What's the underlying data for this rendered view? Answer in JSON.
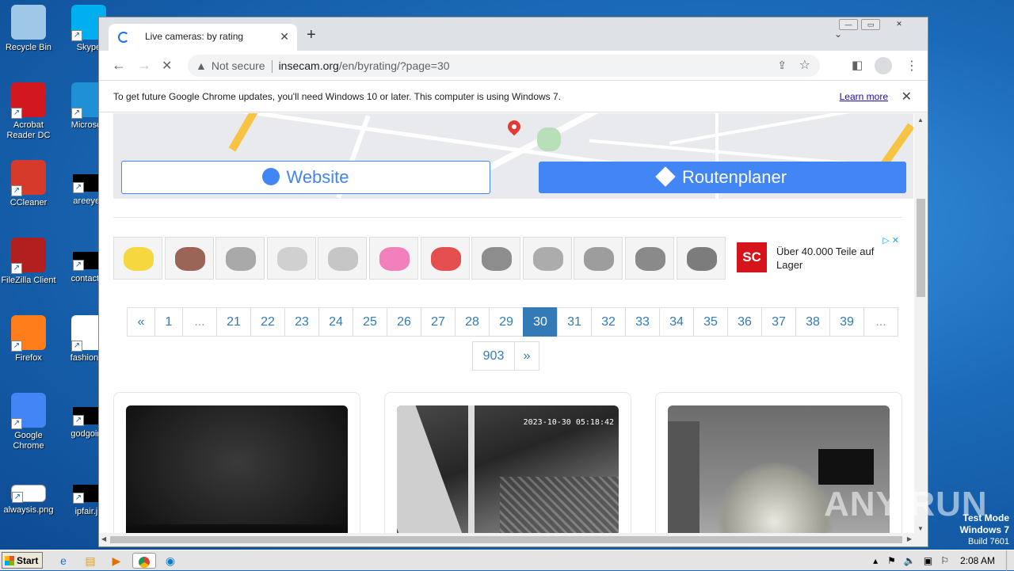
{
  "desktop": {
    "icons_col1": [
      {
        "label": "Recycle Bin",
        "icon": "recycle-bin-icon"
      },
      {
        "label": "Acrobat Reader DC",
        "icon": "acrobat-icon"
      },
      {
        "label": "CCleaner",
        "icon": "ccleaner-icon"
      },
      {
        "label": "FileZilla Client",
        "icon": "filezilla-icon"
      },
      {
        "label": "Firefox",
        "icon": "firefox-icon"
      },
      {
        "label": "Google Chrome",
        "icon": "chrome-icon"
      },
      {
        "label": "alwaysis.png",
        "icon": "image-file-icon"
      }
    ],
    "icons_col2": [
      {
        "label": "Skype",
        "icon": "skype-icon"
      },
      {
        "label": "Microsoft",
        "icon": "edge-icon"
      },
      {
        "label": "areeyes",
        "icon": "file-icon"
      },
      {
        "label": "contactfri",
        "icon": "file-icon"
      },
      {
        "label": "fashionsy",
        "icon": "word-icon"
      },
      {
        "label": "godgoing",
        "icon": "file-icon"
      },
      {
        "label": "ipfair.jp",
        "icon": "file-icon"
      }
    ]
  },
  "browser": {
    "tab_title": "Live cameras: by rating",
    "new_tab": "+",
    "url_warning": "Not secure",
    "url_domain": "insecam.org",
    "url_path": "/en/byrating/?page=30",
    "infobar_text": "To get future Google Chrome updates, you'll need Windows 10 or later. This computer is using Windows 7.",
    "infobar_link": "Learn more"
  },
  "map": {
    "website_label": "Website",
    "route_label": "Routenplaner"
  },
  "ad": {
    "text": "Über 40.000 Teile auf Lager",
    "logo": "SC",
    "item_count": 12
  },
  "pagination": {
    "prev": "«",
    "next": "»",
    "pages": [
      "1",
      "...",
      "21",
      "22",
      "23",
      "24",
      "25",
      "26",
      "27",
      "28",
      "29",
      "30",
      "31",
      "32",
      "33",
      "34",
      "35",
      "36",
      "37",
      "38",
      "39",
      "..."
    ],
    "last": "903",
    "current": "30"
  },
  "cameras": [
    {
      "timestamp": ""
    },
    {
      "timestamp": "2023-10-30 05:18:42"
    },
    {
      "timestamp": ""
    }
  ],
  "watermark": "ANY RUN",
  "os": {
    "test_mode": "Test Mode",
    "version": "Windows 7",
    "build": "Build 7601",
    "start_label": "Start",
    "clock": "2:08 AM"
  }
}
